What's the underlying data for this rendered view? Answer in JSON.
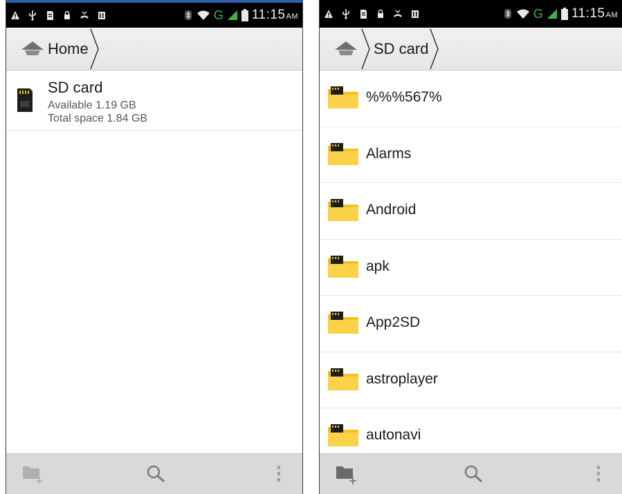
{
  "status_bar": {
    "time": "11:15",
    "ampm": "AM",
    "network": "G"
  },
  "left": {
    "breadcrumb": "Home",
    "storage": {
      "name": "SD card",
      "available": "Available 1.19 GB",
      "total": "Total space 1.84 GB"
    }
  },
  "right": {
    "breadcrumb": "SD card",
    "folders": [
      {
        "name": "%%%567%"
      },
      {
        "name": "Alarms"
      },
      {
        "name": "Android"
      },
      {
        "name": "apk"
      },
      {
        "name": "App2SD"
      },
      {
        "name": "astroplayer"
      },
      {
        "name": "autonavi"
      }
    ]
  },
  "icons": {
    "home": "home-icon",
    "sd": "sd-card-icon",
    "folder": "folder-icon",
    "new_folder": "new-folder-icon",
    "search": "search-icon",
    "overflow": "overflow-menu-icon"
  },
  "colors": {
    "status_bar": "#000000",
    "accent": "#2e5fa8",
    "folder": "#f4c21e",
    "signal": "#39b54a"
  }
}
